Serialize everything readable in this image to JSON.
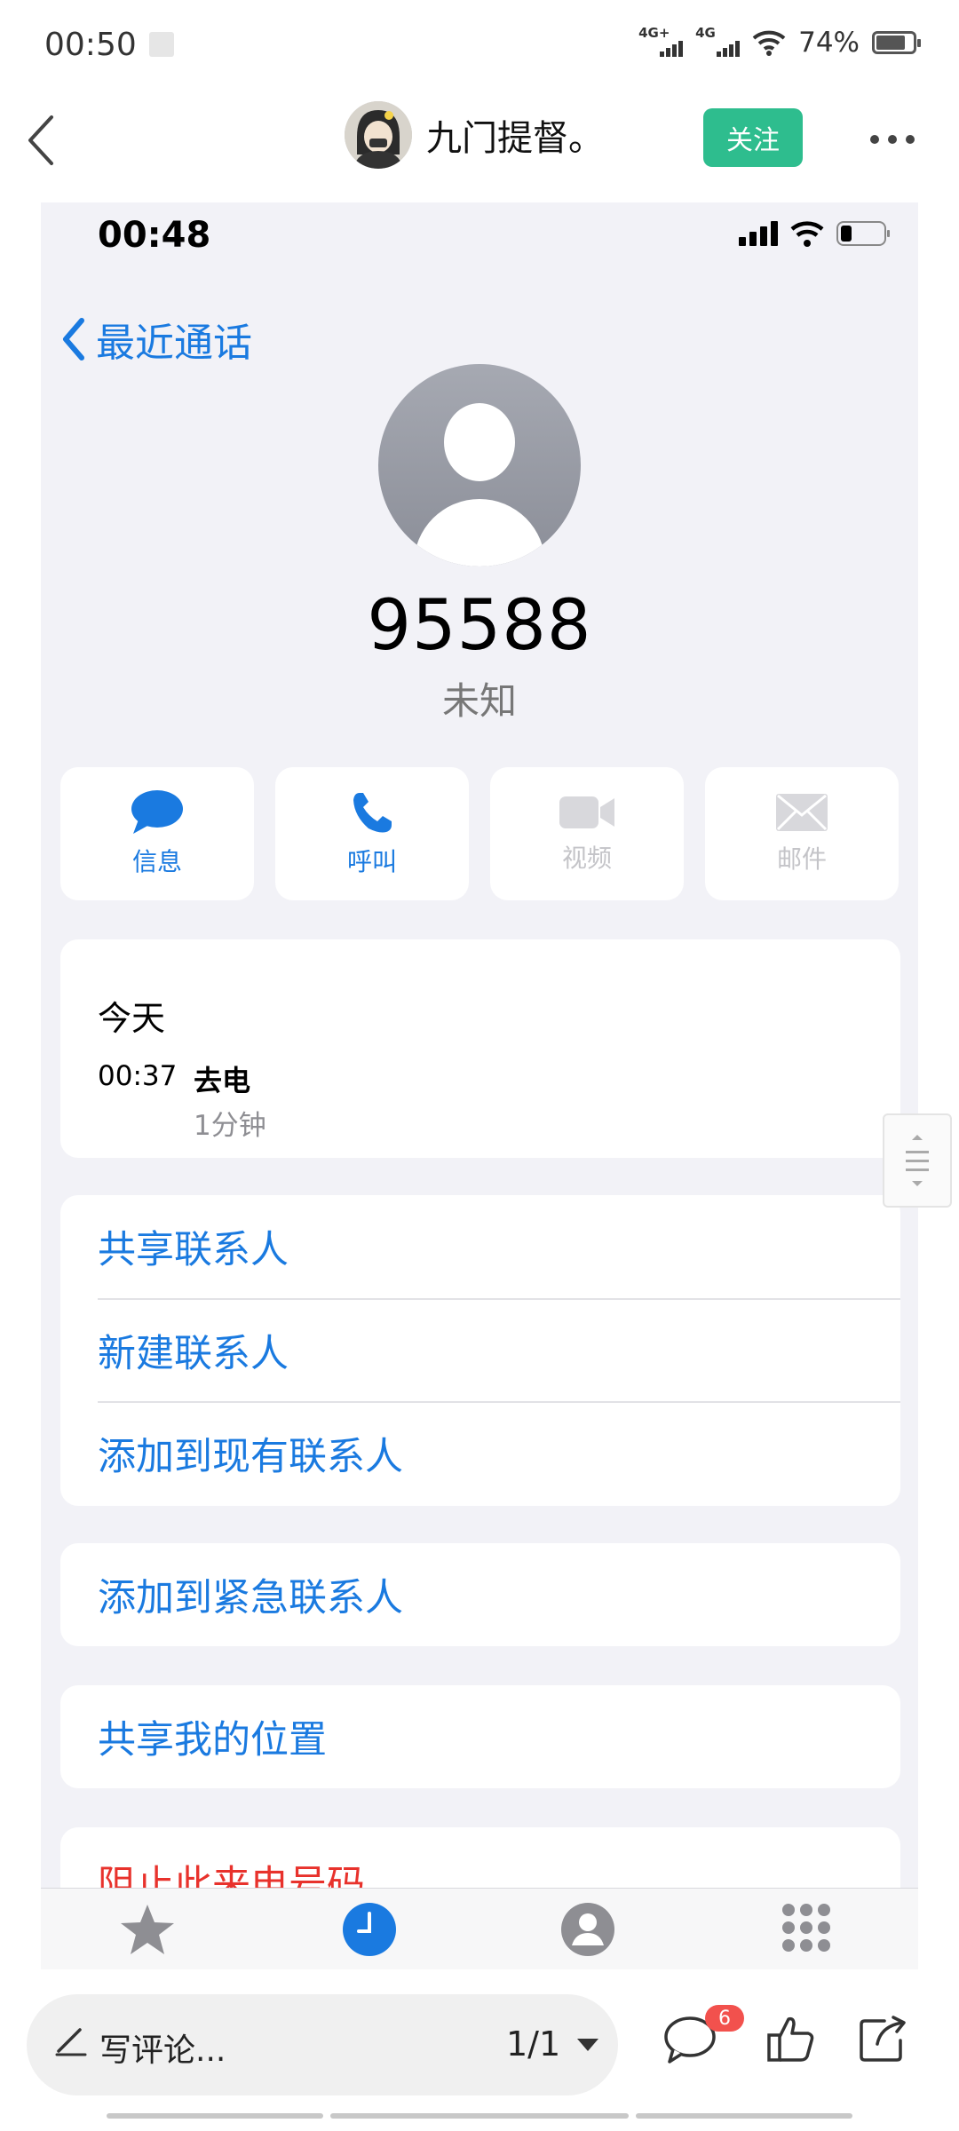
{
  "status_bar": {
    "time": "00:50",
    "signal_1": "4G+",
    "signal_2": "4G",
    "battery": "74%"
  },
  "header": {
    "username": "九门提督。",
    "follow_label": "关注"
  },
  "screenshot": {
    "ios_time": "00:48",
    "back_label": "最近通话",
    "number": "95588",
    "subtitle": "未知",
    "actions": [
      {
        "label": "信息",
        "icon": "message-icon",
        "enabled": true
      },
      {
        "label": "呼叫",
        "icon": "phone-icon",
        "enabled": true
      },
      {
        "label": "视频",
        "icon": "video-icon",
        "enabled": false
      },
      {
        "label": "邮件",
        "icon": "mail-icon",
        "enabled": false
      }
    ],
    "call_log": {
      "day": "今天",
      "time": "00:37",
      "type": "去电",
      "duration": "1分钟"
    },
    "contact_options": [
      "共享联系人",
      "新建联系人",
      "添加到现有联系人"
    ],
    "emergency": "添加到紧急联系人",
    "share_location": "共享我的位置",
    "block": "阻止此来电号码",
    "tabs": [
      "favorites-icon",
      "recents-icon",
      "contacts-icon",
      "keypad-icon"
    ],
    "accent_color": "#1a7ae0"
  },
  "bottom_bar": {
    "comment_placeholder": "写评论...",
    "page": "1/1",
    "comment_count": "6"
  }
}
